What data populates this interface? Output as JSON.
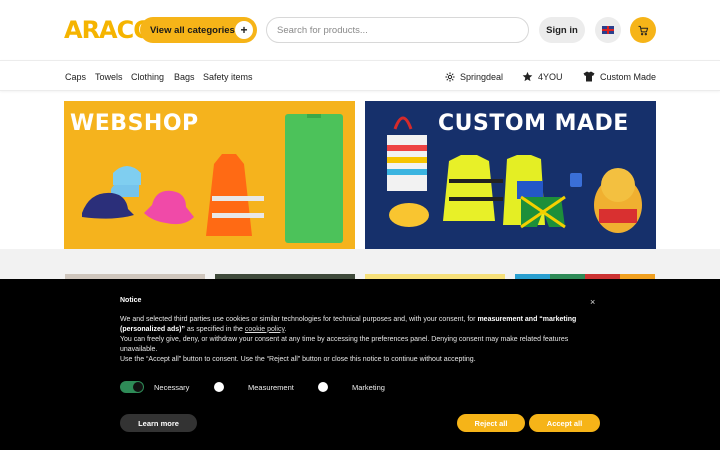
{
  "header": {
    "logo_text": "ARACO",
    "categories_button": "View all categories",
    "search_placeholder": "Search for products...",
    "signin_label": "Sign in"
  },
  "nav": {
    "left_links": [
      "Caps",
      "Towels",
      "Clothing",
      "Bags",
      "Safety items"
    ],
    "right_links": [
      "Springdeal",
      "4YOU",
      "Custom Made"
    ]
  },
  "banners": {
    "left_title": "WEBSHOP",
    "right_title": "CUSTOM MADE"
  },
  "cookie": {
    "title": "Notice",
    "p1_a": "We and selected third parties use cookies or similar technologies for technical purposes and, with your consent, for ",
    "p1_b": "measurement and “marketing (personalized ads)”",
    "p1_c": " as specified in the ",
    "p1_link": "cookie policy",
    "p1_d": ".",
    "p2": "You can freely give, deny, or withdraw your consent at any time by accessing the preferences panel. Denying consent may make related features unavailable.",
    "p3": "Use the “Accept all” button to consent. Use the “Reject all” button or close this notice to continue without accepting.",
    "toggles": [
      "Necessary",
      "Measurement",
      "Marketing"
    ],
    "learn_more": "Learn more",
    "reject_all": "Reject all",
    "accept_all": "Accept all",
    "close_glyph": "×"
  },
  "colors": {
    "brand_yellow": "#f6b418",
    "banner_blue": "#16306b",
    "cookie_bg": "#000000",
    "toggle_on": "#2e8b57"
  }
}
